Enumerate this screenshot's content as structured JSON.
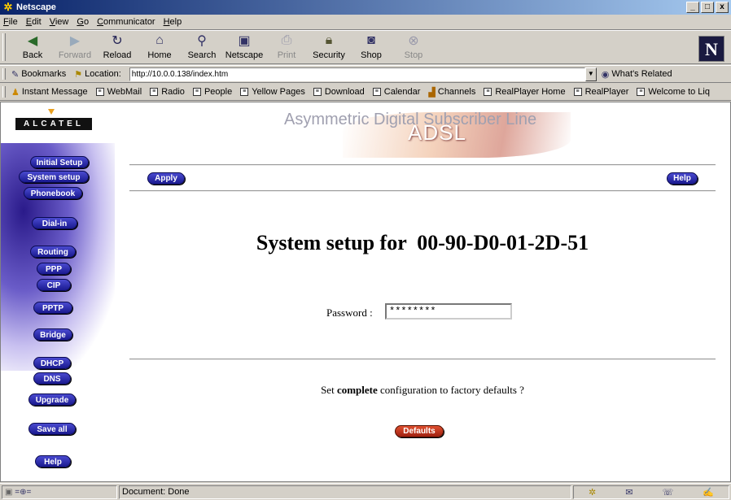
{
  "window": {
    "title": "Netscape",
    "buttons": [
      "_",
      "□",
      "x"
    ]
  },
  "menu": [
    "File",
    "Edit",
    "View",
    "Go",
    "Communicator",
    "Help"
  ],
  "toolbar": {
    "back": "Back",
    "forward": "Forward",
    "reload": "Reload",
    "home": "Home",
    "search": "Search",
    "netscape": "Netscape",
    "print": "Print",
    "security": "Security",
    "shop": "Shop",
    "stop": "Stop"
  },
  "location": {
    "bookmarks": "Bookmarks",
    "label": "Location:",
    "url": "http://10.0.0.138/index.htm",
    "related": "What's Related"
  },
  "personal": [
    "Instant Message",
    "WebMail",
    "Radio",
    "People",
    "Yellow Pages",
    "Download",
    "Calendar",
    "Channels",
    "RealPlayer Home",
    "RealPlayer",
    "Welcome to Liq"
  ],
  "sidebar": {
    "logo": "ALCATEL",
    "items": [
      "Initial Setup",
      "System setup",
      "Phonebook",
      "Dial-in",
      "Routing",
      "PPP",
      "CIP",
      "PPTP",
      "Bridge",
      "DHCP",
      "DNS",
      "Upgrade",
      "Save all",
      "Help"
    ]
  },
  "banner": {
    "tagline": "Asymmetric Digital Subscriber Line",
    "product": "ADSL"
  },
  "page": {
    "apply": "Apply",
    "help": "Help",
    "heading": "System setup for  00-90-D0-01-2D-51",
    "password_label": "Password :",
    "password_value": "********",
    "factory_prefix": "Set ",
    "factory_bold": "complete",
    "factory_suffix": " configuration to factory defaults ?",
    "defaults": "Defaults"
  },
  "status": {
    "text": "Document: Done"
  }
}
